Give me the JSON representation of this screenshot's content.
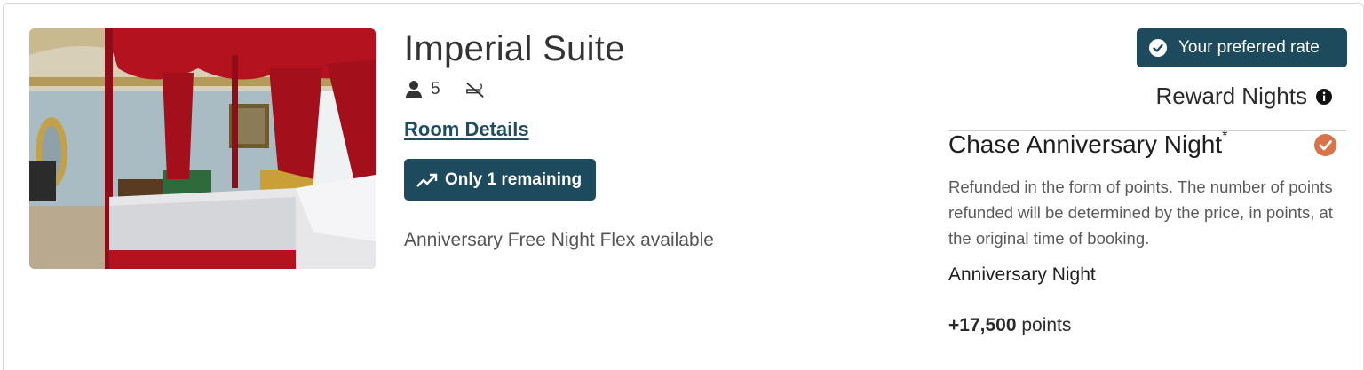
{
  "room": {
    "name": "Imperial Suite",
    "guest_count": "5",
    "room_details_label": "Room Details",
    "remaining_label": "Only 1 remaining",
    "availability_note": "Anniversary Free Night Flex available",
    "photo_icon": "room-photo",
    "amenity_icons": [
      "person-icon",
      "no-smoking-icon"
    ]
  },
  "rate": {
    "preferred_label": "Your preferred rate",
    "rate_type": "Reward Nights",
    "offer_title": "Chase Anniversary Night",
    "offer_title_mark": "*",
    "offer_description": "Refunded in the form of points. The number of points refunded will be determined by the price, in points, at the original time of booking.",
    "offer_name": "Anniversary Night",
    "price_amount": "+17,500",
    "price_unit": "points"
  },
  "colors": {
    "brand_dark": "#1d4a5c",
    "link": "#1f4e63",
    "selected_check": "#d9744a"
  }
}
